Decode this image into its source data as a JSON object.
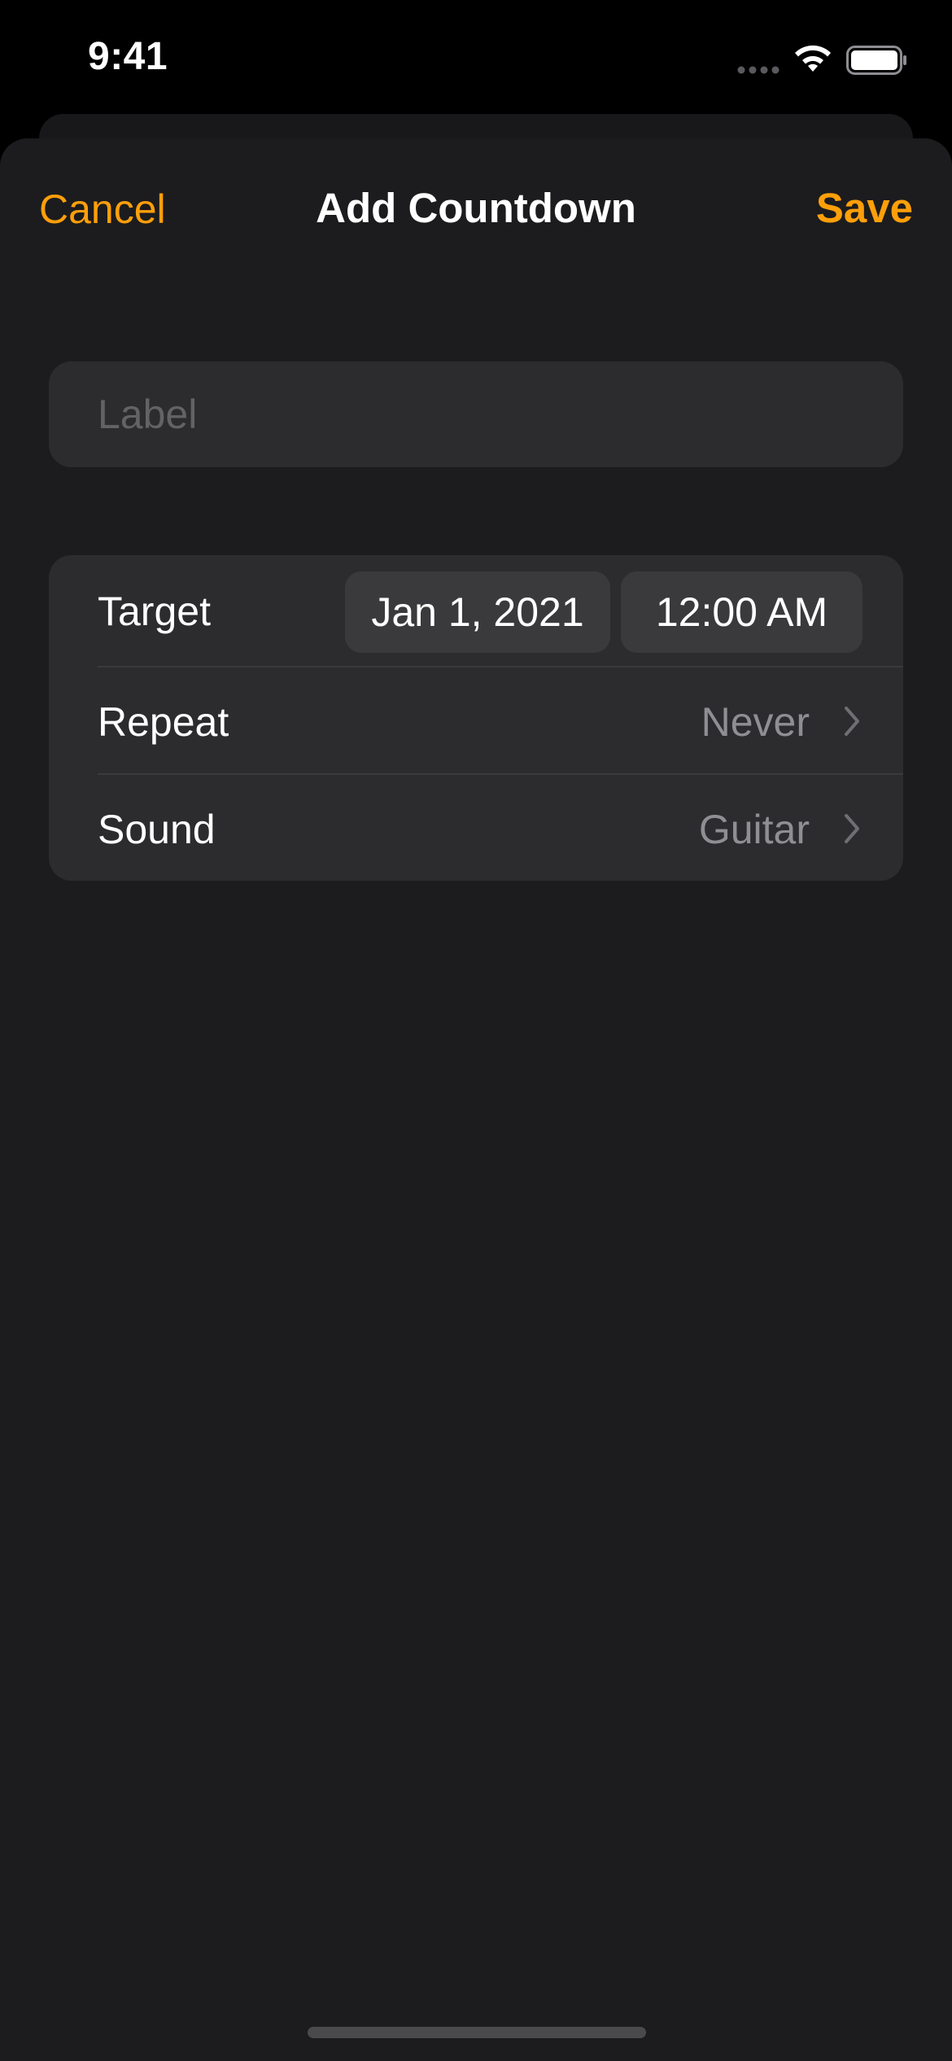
{
  "status_bar": {
    "time": "9:41",
    "icons": [
      "signal-icon",
      "wifi-icon",
      "battery-icon"
    ]
  },
  "nav": {
    "cancel_label": "Cancel",
    "title": "Add Countdown",
    "save_label": "Save"
  },
  "label_field": {
    "placeholder": "Label",
    "value": ""
  },
  "settings": {
    "target": {
      "label": "Target",
      "date": "Jan 1, 2021",
      "time": "12:00 AM"
    },
    "repeat": {
      "label": "Repeat",
      "value": "Never"
    },
    "sound": {
      "label": "Sound",
      "value": "Guitar"
    }
  },
  "colors": {
    "accent": "#ff9f0a",
    "sheet_background": "#1c1c1e",
    "group_background": "#2c2c2e",
    "secondary_text": "#8e8e93"
  }
}
